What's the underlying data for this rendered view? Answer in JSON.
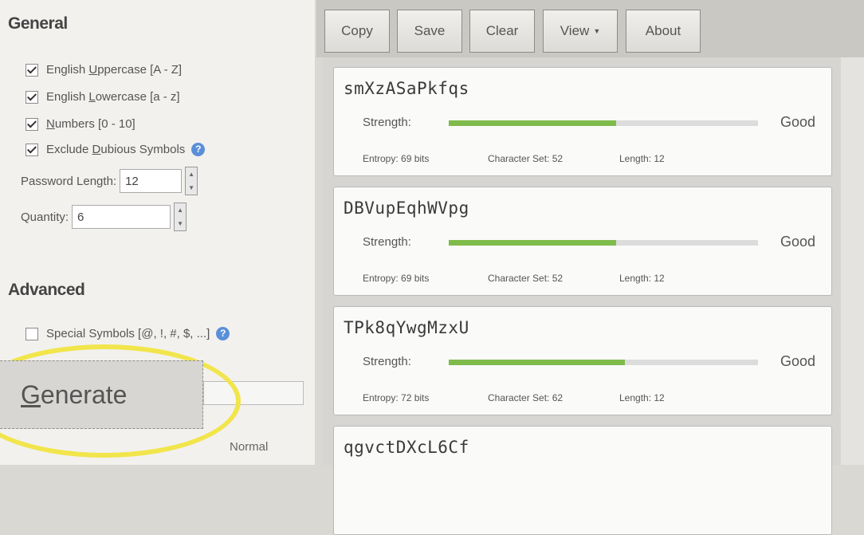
{
  "general": {
    "title": "General",
    "options": [
      {
        "pre": "English ",
        "ul": "U",
        "post": "ppercase [A - Z]",
        "checked": true
      },
      {
        "pre": "English ",
        "ul": "L",
        "post": "owercase [a - z]",
        "checked": true
      },
      {
        "pre": "",
        "ul": "N",
        "post": "umbers [0 - 10]",
        "checked": true
      },
      {
        "pre": "Exclude ",
        "ul": "D",
        "post": "ubious Symbols",
        "checked": true
      }
    ],
    "length_label": "Password Length:",
    "length_value": "12",
    "quantity_label": "Quantity:",
    "quantity_value": "6"
  },
  "advanced": {
    "title": "Advanced",
    "special_label": "Special Symbols [@, !, #, $, ...]",
    "special_checked": false
  },
  "generate": {
    "ul": "G",
    "rest": "enerate"
  },
  "normal_label": "Normal",
  "toolbar": {
    "copy": "Copy",
    "save": "Save",
    "clear": "Clear",
    "view": "View",
    "about": "About"
  },
  "results": [
    {
      "password": "smXzASaPkfqs",
      "strength_label": "Strength:",
      "strength": "Good",
      "strength_level": 0.54,
      "entropy": "Entropy: 69 bits",
      "charset": "Character Set: 52",
      "length": "Length: 12"
    },
    {
      "password": "DBVupEqhWVpg",
      "strength_label": "Strength:",
      "strength": "Good",
      "strength_level": 0.54,
      "entropy": "Entropy: 69 bits",
      "charset": "Character Set: 52",
      "length": "Length: 12"
    },
    {
      "password": "TPk8qYwgMzxU",
      "strength_label": "Strength:",
      "strength": "Good",
      "strength_level": 0.57,
      "entropy": "Entropy: 72 bits",
      "charset": "Character Set: 62",
      "length": "Length: 12"
    },
    {
      "password": "qgvctDXcL6Cf"
    }
  ],
  "colors": {
    "strength_bar": "#7fbb4b",
    "highlight": "#f1e54b",
    "help_icon": "#5a8fd8"
  }
}
